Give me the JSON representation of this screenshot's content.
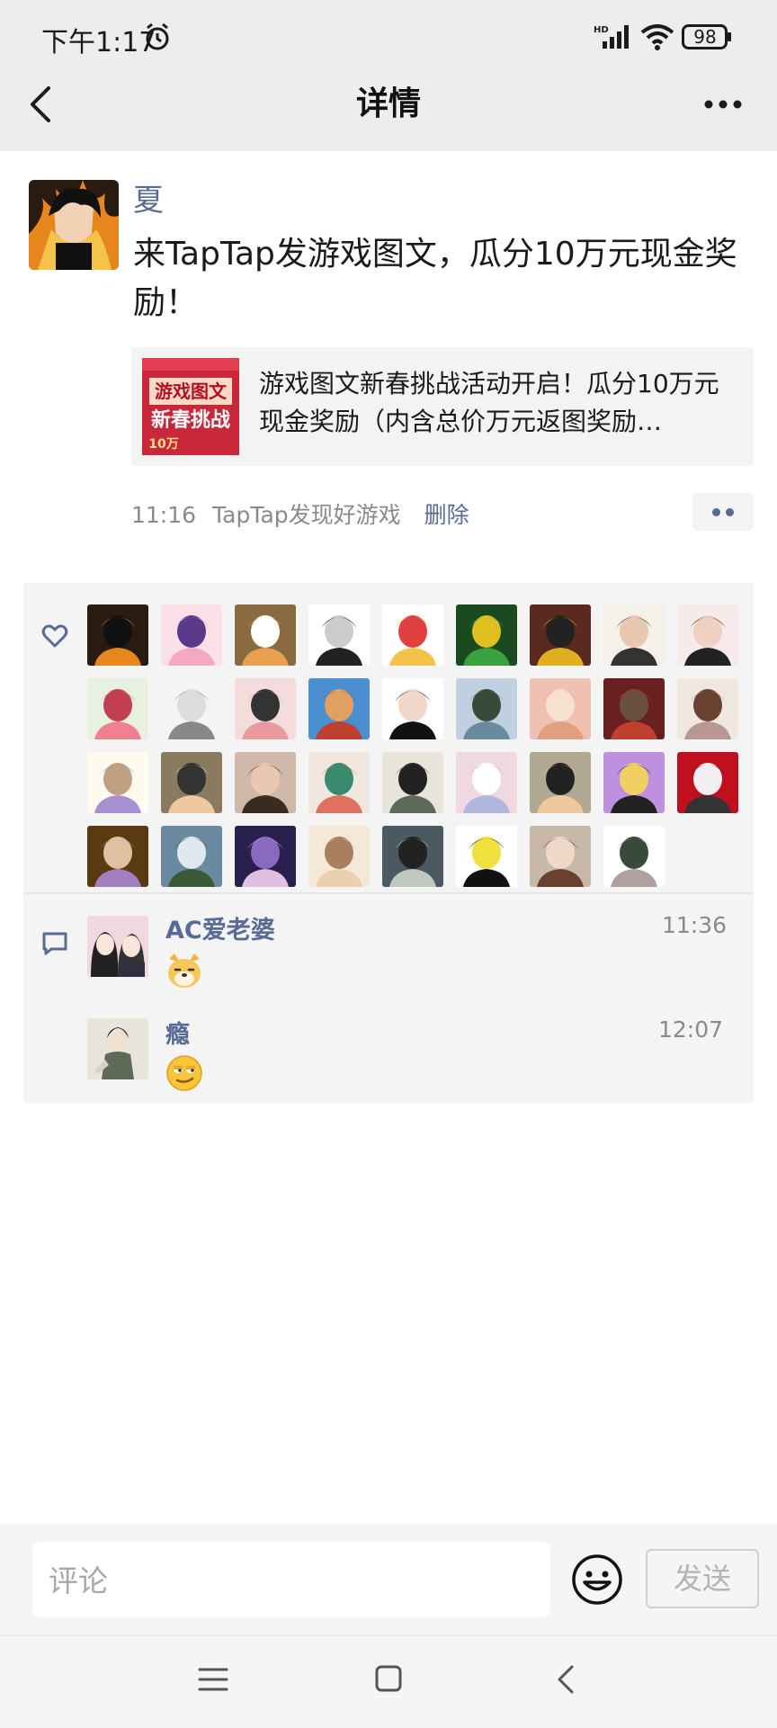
{
  "status_bar": {
    "time": "下午1:17",
    "battery": "98",
    "network": "HD",
    "icons": [
      "alarm-icon",
      "signal-icon",
      "wifi-icon",
      "battery-icon"
    ]
  },
  "header": {
    "title": "详情",
    "back_icon": "chevron-left-icon",
    "more_icon": "more-dots-icon"
  },
  "post": {
    "author": "夏",
    "text": "来TapTap发游戏图文，瓜分10万元现金奖励！",
    "link": {
      "title": "游戏图文新春挑战活动开启！瓜分10万元现金奖励（内含总价万元返图奖励…",
      "thumb_text": {
        "top": "游戏图文",
        "bottom": "新春挑战",
        "tag": "10万"
      }
    },
    "time": "11:16",
    "source": "TapTap发现好游戏",
    "delete_label": "删除"
  },
  "likes": {
    "icon": "heart-icon",
    "count": 35
  },
  "comments": {
    "icon": "comment-bubble-icon",
    "items": [
      {
        "name": "AC爱老婆",
        "time": "11:36",
        "content_emoji": "dog-face-emoji"
      },
      {
        "name": "瘾",
        "time": "12:07",
        "content_emoji": "smirk-emoji"
      }
    ]
  },
  "comment_bar": {
    "placeholder": "评论",
    "send_label": "发送",
    "emoji_icon": "smiley-icon"
  },
  "nav": {
    "icons": [
      "menu-icon",
      "home-icon",
      "back-icon"
    ]
  },
  "colors": {
    "link": "#576b95",
    "page_bg": "#ffffff",
    "header_bg": "#ededed",
    "panel_bg": "#f4f4f4"
  }
}
